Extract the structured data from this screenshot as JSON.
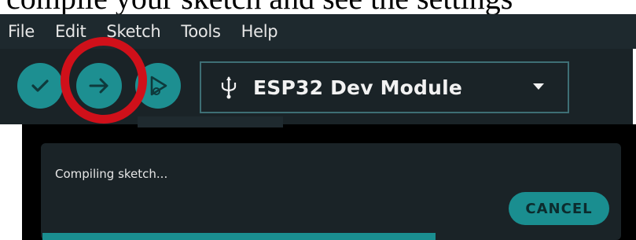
{
  "caption": {
    "text": "compile your sketch and see the settings"
  },
  "menu": {
    "items": [
      {
        "label": "File"
      },
      {
        "label": "Edit"
      },
      {
        "label": "Sketch"
      },
      {
        "label": "Tools"
      },
      {
        "label": "Help"
      }
    ]
  },
  "toolbar": {
    "verify_icon": "check-icon",
    "upload_icon": "arrow-right-icon",
    "debug_icon": "debug-icon",
    "board": {
      "label": "ESP32 Dev Module",
      "icon": "usb-icon"
    }
  },
  "notification": {
    "message": "Compiling sketch...",
    "cancel_label": "CANCEL"
  },
  "colors": {
    "accent": "#1d8f91",
    "highlight": "#d0101a",
    "background": "#1a2327"
  }
}
